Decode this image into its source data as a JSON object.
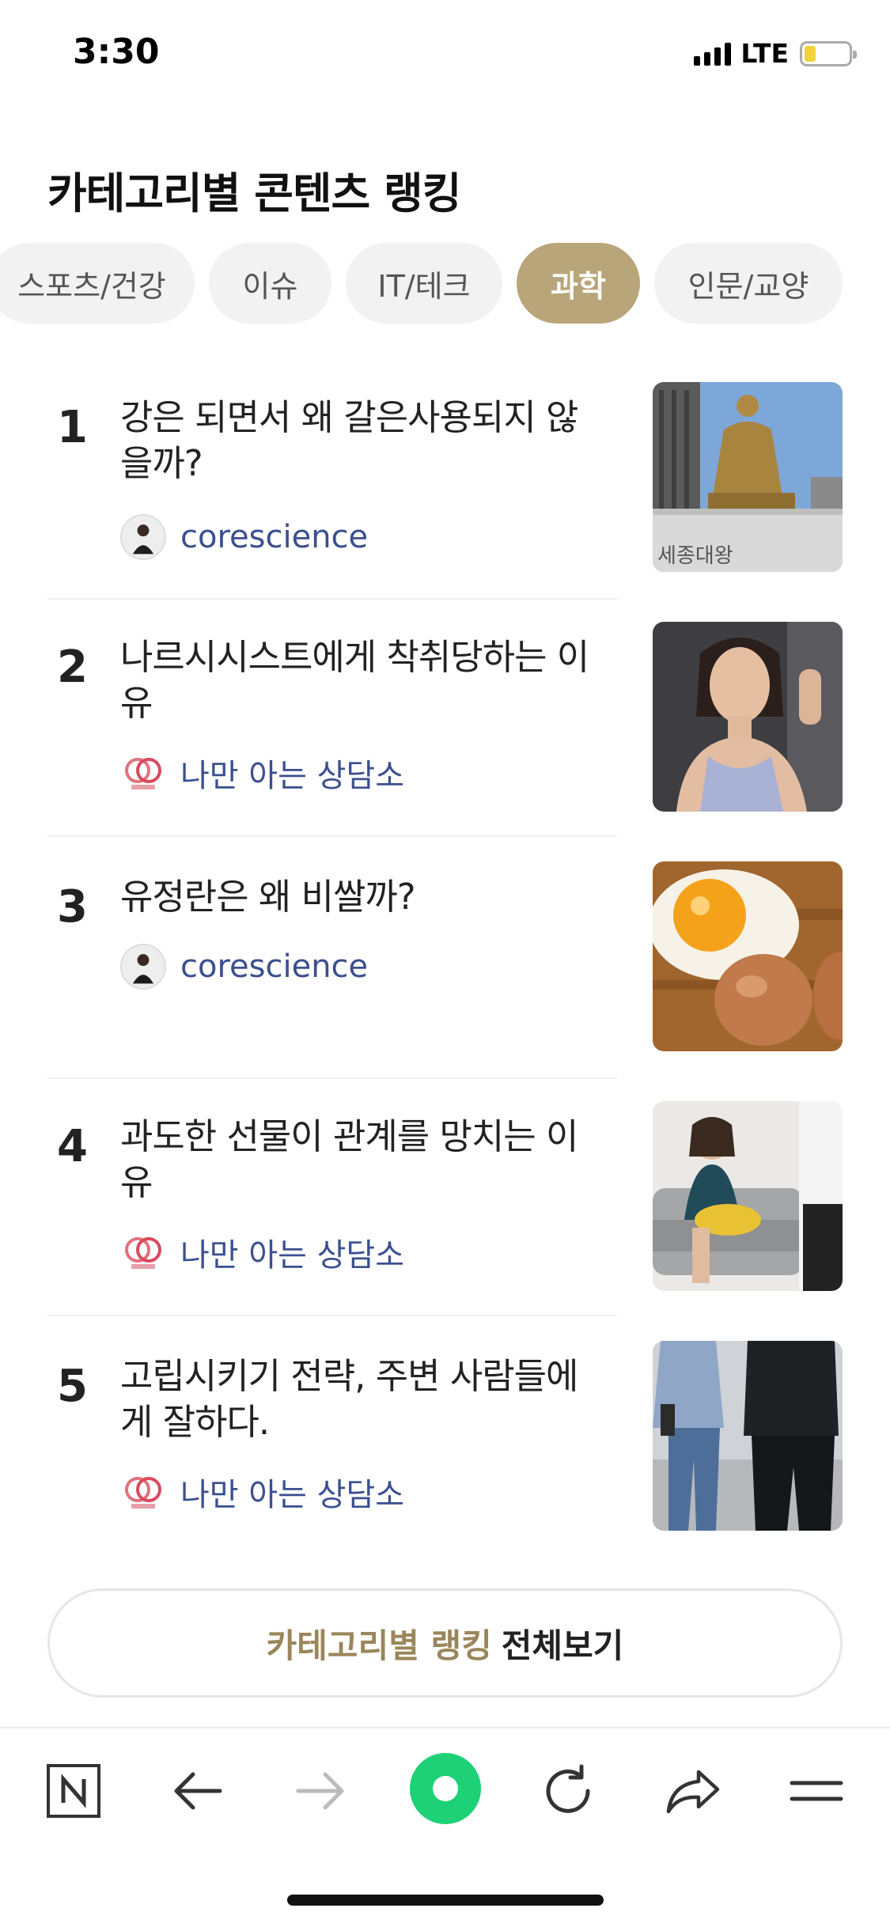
{
  "status_bar": {
    "time": "3:30",
    "network": "LTE",
    "battery_level": 0.2
  },
  "page": {
    "heading": "카테고리별 콘텐츠 랭킹"
  },
  "tabs": [
    {
      "label": "스포츠/건강",
      "active": false
    },
    {
      "label": "이슈",
      "active": false
    },
    {
      "label": "IT/테크",
      "active": false
    },
    {
      "label": "과학",
      "active": true
    },
    {
      "label": "인문/교양",
      "active": false
    }
  ],
  "rankings": [
    {
      "rank": "1",
      "title": "강은 되면서 왜 갈은사용되지 않을까?",
      "author": "corescience",
      "author_icon": "person-avatar-icon",
      "thumbnail": "statue-photo",
      "thumbnail_text": "세종대왕"
    },
    {
      "rank": "2",
      "title": "나르시시스트에게 착취당하는 이유",
      "author": "나만 아는 상담소",
      "author_icon": "counseling-logo-icon",
      "thumbnail": "woman-photo"
    },
    {
      "rank": "3",
      "title": "유정란은 왜 비쌀까?",
      "author": "corescience",
      "author_icon": "person-avatar-icon",
      "thumbnail": "eggs-photo"
    },
    {
      "rank": "4",
      "title": "과도한 선물이 관계를 망치는 이유",
      "author": "나만 아는 상담소",
      "author_icon": "counseling-logo-icon",
      "thumbnail": "couch-photo"
    },
    {
      "rank": "5",
      "title": "고립시키기 전략, 주변 사람들에게 잘하다.",
      "author": "나만 아는 상담소",
      "author_icon": "counseling-logo-icon",
      "thumbnail": "walking-photo"
    }
  ],
  "more_button": {
    "accent": "카테고리별 랭킹",
    "rest": "전체보기"
  },
  "toolbar": [
    "naver-home-icon",
    "back-arrow-icon",
    "forward-arrow-icon",
    "green-dot-icon",
    "refresh-icon",
    "share-icon",
    "menu-icon"
  ],
  "colors": {
    "accent": "#b8a67a",
    "author": "#3b4f8f",
    "green": "#1ed177"
  }
}
